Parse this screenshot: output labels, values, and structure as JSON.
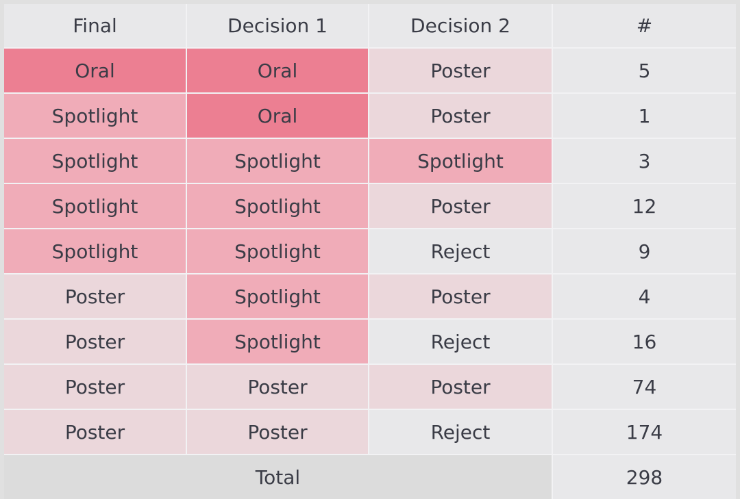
{
  "table": {
    "columns": [
      {
        "key": "final",
        "label": "Final"
      },
      {
        "key": "decision1",
        "label": "Decision 1"
      },
      {
        "key": "decision2",
        "label": "Decision 2"
      },
      {
        "key": "count",
        "label": "#"
      }
    ],
    "rows": [
      {
        "final": "Oral",
        "decision1": "Oral",
        "decision2": "Poster",
        "count": "5"
      },
      {
        "final": "Spotlight",
        "decision1": "Oral",
        "decision2": "Poster",
        "count": "1"
      },
      {
        "final": "Spotlight",
        "decision1": "Spotlight",
        "decision2": "Spotlight",
        "count": "3"
      },
      {
        "final": "Spotlight",
        "decision1": "Spotlight",
        "decision2": "Poster",
        "count": "12"
      },
      {
        "final": "Spotlight",
        "decision1": "Spotlight",
        "decision2": "Reject",
        "count": "9"
      },
      {
        "final": "Poster",
        "decision1": "Spotlight",
        "decision2": "Poster",
        "count": "4"
      },
      {
        "final": "Poster",
        "decision1": "Spotlight",
        "decision2": "Reject",
        "count": "16"
      },
      {
        "final": "Poster",
        "decision1": "Poster",
        "decision2": "Poster",
        "count": "74"
      },
      {
        "final": "Poster",
        "decision1": "Poster",
        "decision2": "Reject",
        "count": "174"
      }
    ],
    "total": {
      "label": "Total",
      "count": "298"
    }
  },
  "colors": {
    "oral": "#ec7f92",
    "spotlight": "#f0acb8",
    "poster": "#ebd7db",
    "reject": "#e8e8ea",
    "header": "#e8e8ea",
    "total": "#dcdcdc",
    "text": "#3a3c46",
    "grid": "#f2f2f4",
    "page_background": "#e0e0e0"
  },
  "chart_data": {
    "type": "table",
    "title": "",
    "columns": [
      "Final",
      "Decision 1",
      "Decision 2",
      "#"
    ],
    "rows": [
      [
        "Oral",
        "Oral",
        "Poster",
        5
      ],
      [
        "Spotlight",
        "Oral",
        "Poster",
        1
      ],
      [
        "Spotlight",
        "Spotlight",
        "Spotlight",
        3
      ],
      [
        "Spotlight",
        "Spotlight",
        "Poster",
        12
      ],
      [
        "Spotlight",
        "Spotlight",
        "Reject",
        9
      ],
      [
        "Poster",
        "Spotlight",
        "Poster",
        4
      ],
      [
        "Poster",
        "Spotlight",
        "Reject",
        16
      ],
      [
        "Poster",
        "Poster",
        "Poster",
        74
      ],
      [
        "Poster",
        "Poster",
        "Reject",
        174
      ]
    ],
    "total_label": "Total",
    "total_value": 298,
    "categories": [
      "Oral",
      "Spotlight",
      "Poster",
      "Reject"
    ],
    "cell_color_map": {
      "Oral": "#ec7f92",
      "Spotlight": "#f0acb8",
      "Poster": "#ebd7db",
      "Reject": "#e8e8ea"
    }
  }
}
